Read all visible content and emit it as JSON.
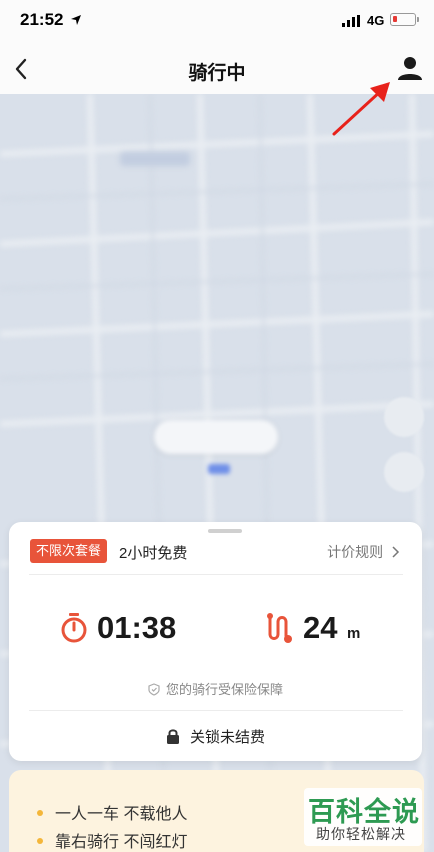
{
  "status_bar": {
    "time": "21:52",
    "network": "4G",
    "icons": [
      "location-arrow-icon",
      "signal-icon",
      "battery-icon"
    ]
  },
  "header": {
    "title": "骑行中",
    "back_icon": "chevron-left-icon",
    "profile_icon": "user-icon"
  },
  "ride": {
    "plan_badge": "不限次套餐",
    "free_text": "2小时免费",
    "pricing_link": "计价规则",
    "elapsed_time": "01:38",
    "distance": "24",
    "distance_unit": "m",
    "insurance_text": "您的骑行受保险保障",
    "lock_text": "关锁未结费"
  },
  "tips": {
    "items": [
      "一人一车 不载他人",
      "靠右骑行 不闯红灯"
    ]
  },
  "watermark": {
    "title": "百科全说",
    "subtitle": "助你轻松解决"
  },
  "colors": {
    "accent": "#e8543a",
    "tip_dot": "#f4b63a",
    "annotation": "#e8221b",
    "watermark_green": "#2e9a52"
  }
}
